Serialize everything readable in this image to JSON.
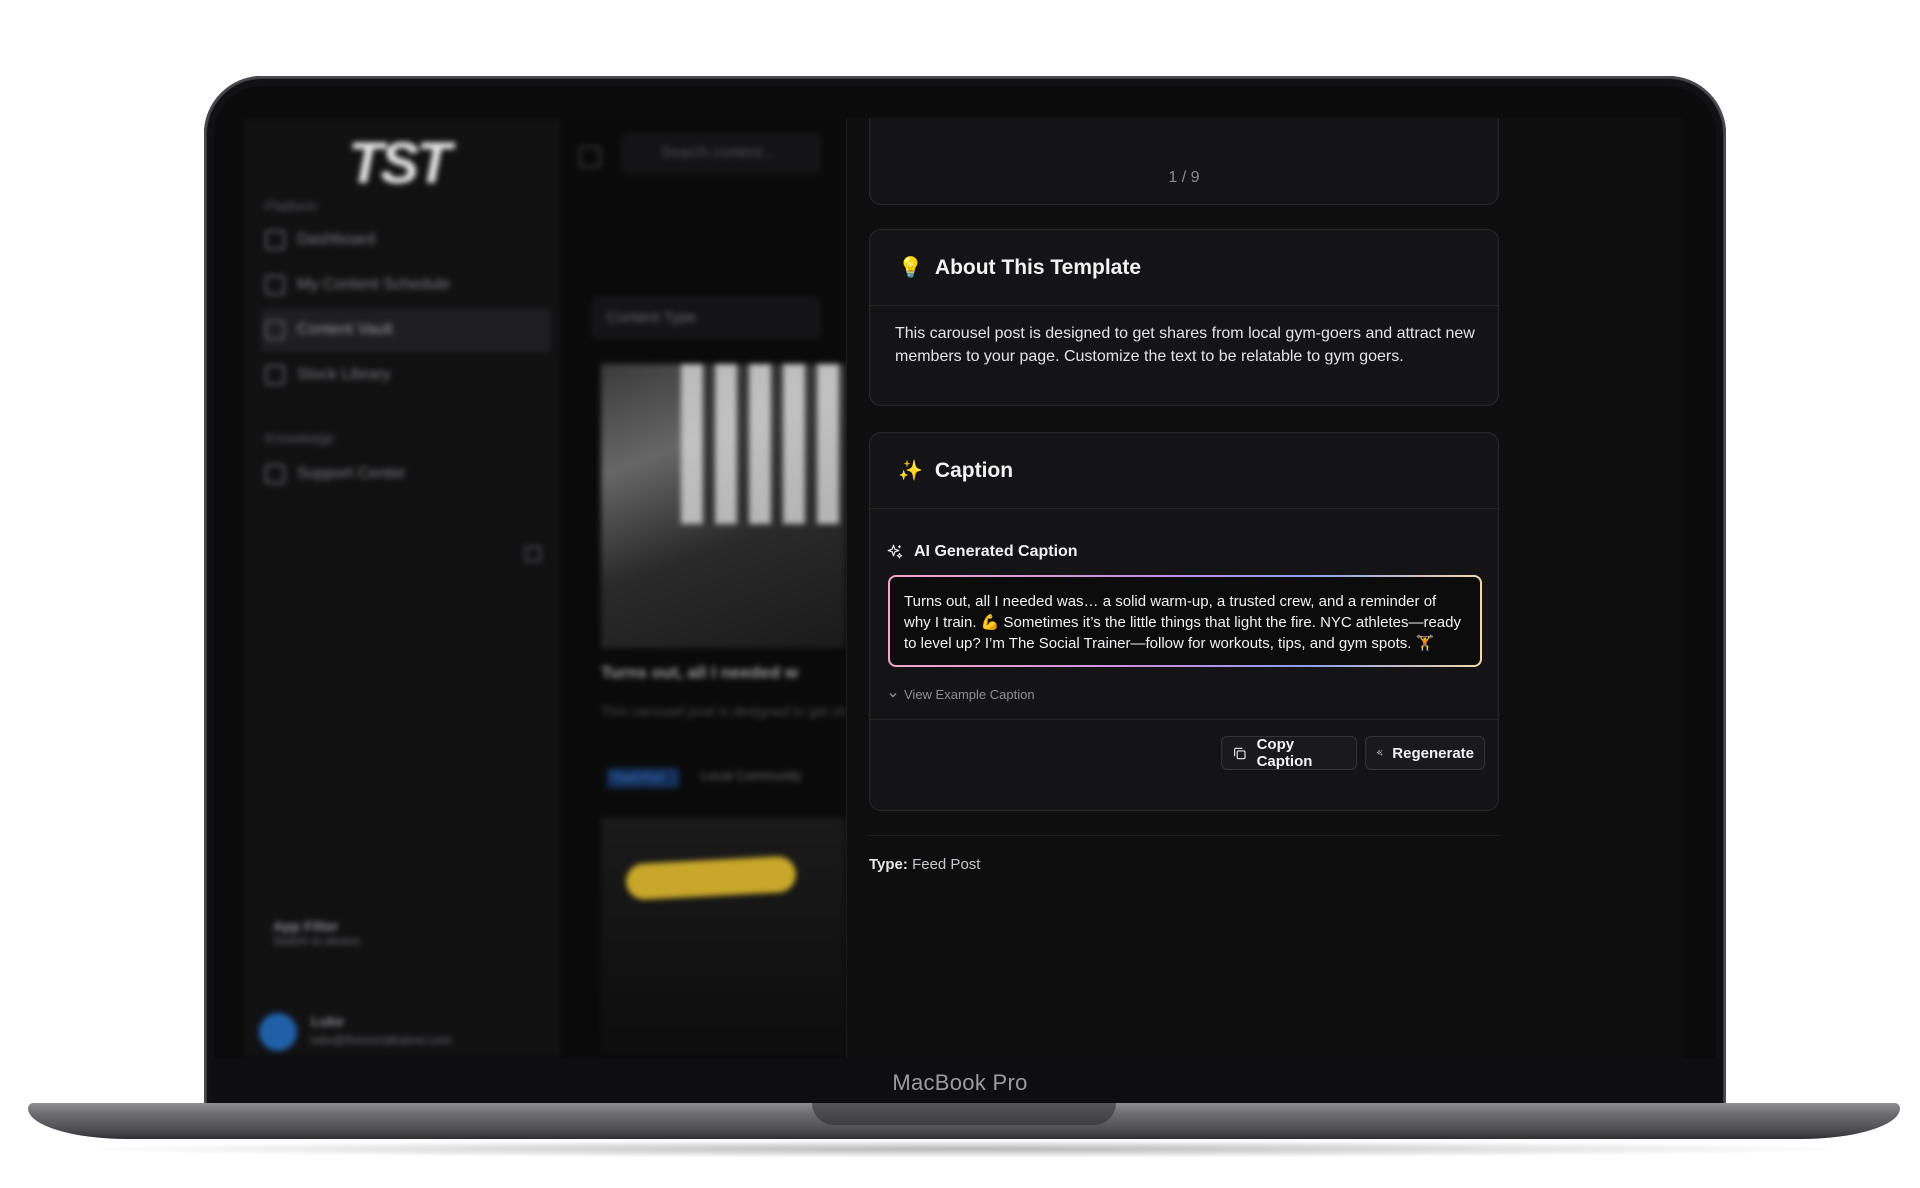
{
  "device": {
    "label": "MacBook Pro"
  },
  "sidebar": {
    "logo": "TST",
    "section_platform": "Platform",
    "items": [
      {
        "label": "Dashboard",
        "icon": "grid-icon"
      },
      {
        "label": "My Content Schedule",
        "icon": "calendar-icon"
      },
      {
        "label": "Content Vault",
        "icon": "folder-icon",
        "active": true
      },
      {
        "label": "Stock Library",
        "icon": "image-icon"
      }
    ],
    "section_knowledge": "Knowledge",
    "support": {
      "label": "Support Center",
      "icon": "external-link-icon"
    },
    "app_card": {
      "title": "App Filter",
      "subtitle": "Switch to device"
    },
    "user": {
      "name": "Luke",
      "email": "luke@thesocialtrainer.com"
    }
  },
  "main": {
    "search_placeholder": "Search content...",
    "filter_label": "Content Type",
    "card_title": "Turns out, all I needed w",
    "card_desc": "This carousel post is designed to get shares from local gym-goers",
    "tag_primary": "Feed Post",
    "tag_secondary": "Local Community"
  },
  "detail": {
    "carousel": {
      "page_indicator": "1 / 9"
    },
    "about": {
      "icon": "lightbulb-icon",
      "title": "About This Template",
      "body": "This carousel post is designed to get shares from local gym-goers and attract new members to your page. Customize the text to be relatable to gym goers."
    },
    "caption": {
      "icon": "sparkles-icon",
      "title": "Caption",
      "ai_label": "AI Generated Caption",
      "text": "Turns out, all I needed was… a solid warm-up, a trusted crew, and a reminder of why I train. 💪 Sometimes it’s the little things that light the fire. NYC athletes—ready to level up? I’m The Social Trainer—follow for workouts, tips, and gym spots. 🏋️",
      "view_example": "View Example Caption",
      "copy_button": "Copy Caption",
      "regenerate_button": "Regenerate"
    },
    "type_label": "Type:",
    "type_value": "Feed Post"
  },
  "colors": {
    "panel_bg": "#0e0e0f",
    "card_bg": "#141416",
    "border": "#2a2a2e",
    "gradient_pink": "#f3a8c6",
    "gradient_purple": "#c48fe3",
    "gradient_blue": "#8c9ef0",
    "gradient_gold": "#f1d9a8"
  }
}
